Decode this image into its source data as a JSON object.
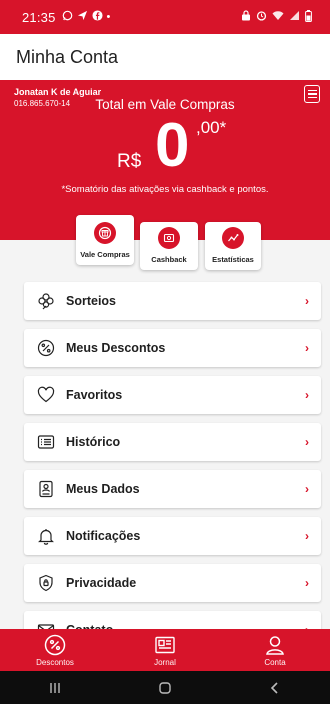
{
  "status_bar": {
    "time": "21:35",
    "left_icons": [
      "whatsapp-icon",
      "navigation-icon",
      "facebook-icon",
      "dot-icon"
    ],
    "right_icons": [
      "lock-icon",
      "alarm-icon",
      "wifi-icon",
      "signal-icon",
      "battery-icon"
    ]
  },
  "header": {
    "title": "Minha Conta"
  },
  "hero": {
    "user_name": "Jonatan K de Aguiar",
    "user_doc": "016.865.670-14",
    "title": "Total em Vale Compras",
    "currency": "R$",
    "amount_int": "0",
    "amount_dec": ",00*",
    "note": "*Somatório das ativações via cashback e pontos.",
    "menu_icon": "menu-icon"
  },
  "tiles": [
    {
      "label": "Vale Compras",
      "icon": "voucher-icon"
    },
    {
      "label": "Cashback",
      "icon": "cashback-icon"
    },
    {
      "label": "Estatísticas",
      "icon": "stats-icon"
    }
  ],
  "menu": [
    {
      "label": "Sorteios",
      "icon": "clover-icon"
    },
    {
      "label": "Meus Descontos",
      "icon": "discount-icon"
    },
    {
      "label": "Favoritos",
      "icon": "heart-icon"
    },
    {
      "label": "Histórico",
      "icon": "list-icon"
    },
    {
      "label": "Meus Dados",
      "icon": "profile-card-icon"
    },
    {
      "label": "Notificações",
      "icon": "bell-icon"
    },
    {
      "label": "Privacidade",
      "icon": "shield-icon"
    },
    {
      "label": "Contato",
      "icon": "mail-icon"
    }
  ],
  "bottom_nav": [
    {
      "label": "Descontos",
      "icon": "discount-icon"
    },
    {
      "label": "Jornal",
      "icon": "newspaper-icon"
    },
    {
      "label": "Conta",
      "icon": "user-icon"
    }
  ],
  "colors": {
    "primary": "#d7142a",
    "background": "#f4f4f4",
    "text": "#1f1f1f"
  }
}
